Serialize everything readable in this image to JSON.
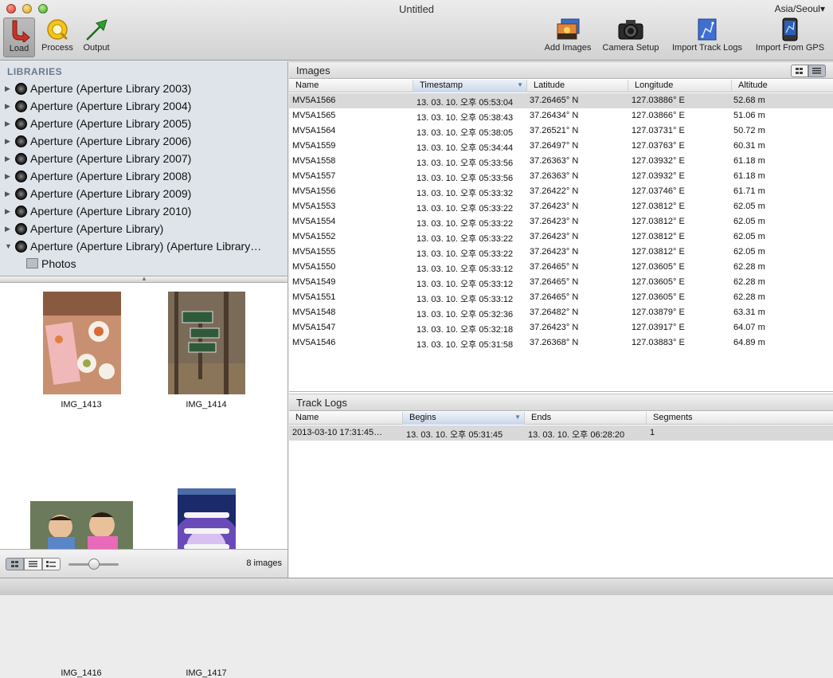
{
  "window": {
    "title": "Untitled",
    "timezone": "Asia/Seoul▾"
  },
  "toolbar": {
    "load": "Load",
    "process": "Process",
    "output": "Output",
    "add_images": "Add Images",
    "camera_setup": "Camera Setup",
    "import_track_logs": "Import Track Logs",
    "import_from_gps": "Import From GPS"
  },
  "sidebar": {
    "header": "LIBRARIES",
    "items": [
      {
        "label": "Aperture (Aperture Library 2003)"
      },
      {
        "label": "Aperture (Aperture Library 2004)"
      },
      {
        "label": "Aperture (Aperture Library 2005)"
      },
      {
        "label": "Aperture (Aperture Library 2006)"
      },
      {
        "label": "Aperture (Aperture Library 2007)"
      },
      {
        "label": "Aperture (Aperture Library 2008)"
      },
      {
        "label": "Aperture (Aperture Library 2009)"
      },
      {
        "label": "Aperture (Aperture Library 2010)"
      },
      {
        "label": "Aperture (Aperture Library)"
      },
      {
        "label": "Aperture (Aperture Library) (Aperture Library…"
      }
    ],
    "child": "Photos"
  },
  "thumbnails": [
    {
      "caption": "IMG_1413"
    },
    {
      "caption": "IMG_1414"
    },
    {
      "caption": "IMG_1416"
    },
    {
      "caption": "IMG_1417"
    }
  ],
  "thumb_status": "8 images",
  "images": {
    "title": "Images",
    "columns": [
      "Name",
      "Timestamp",
      "Latitude",
      "Longitude",
      "Altitude"
    ],
    "rows": [
      [
        "MV5A1566",
        "13. 03. 10. 오후 05:53:04",
        "37.26465° N",
        "127.03886° E",
        "52.68 m"
      ],
      [
        "MV5A1565",
        "13. 03. 10. 오후 05:38:43",
        "37.26434° N",
        "127.03866° E",
        "51.06 m"
      ],
      [
        "MV5A1564",
        "13. 03. 10. 오후 05:38:05",
        "37.26521° N",
        "127.03731° E",
        "50.72 m"
      ],
      [
        "MV5A1559",
        "13. 03. 10. 오후 05:34:44",
        "37.26497° N",
        "127.03763° E",
        "60.31 m"
      ],
      [
        "MV5A1558",
        "13. 03. 10. 오후 05:33:56",
        "37.26363° N",
        "127.03932° E",
        "61.18 m"
      ],
      [
        "MV5A1557",
        "13. 03. 10. 오후 05:33:56",
        "37.26363° N",
        "127.03932° E",
        "61.18 m"
      ],
      [
        "MV5A1556",
        "13. 03. 10. 오후 05:33:32",
        "37.26422° N",
        "127.03746° E",
        "61.71 m"
      ],
      [
        "MV5A1553",
        "13. 03. 10. 오후 05:33:22",
        "37.26423° N",
        "127.03812° E",
        "62.05 m"
      ],
      [
        "MV5A1554",
        "13. 03. 10. 오후 05:33:22",
        "37.26423° N",
        "127.03812° E",
        "62.05 m"
      ],
      [
        "MV5A1552",
        "13. 03. 10. 오후 05:33:22",
        "37.26423° N",
        "127.03812° E",
        "62.05 m"
      ],
      [
        "MV5A1555",
        "13. 03. 10. 오후 05:33:22",
        "37.26423° N",
        "127.03812° E",
        "62.05 m"
      ],
      [
        "MV5A1550",
        "13. 03. 10. 오후 05:33:12",
        "37.26465° N",
        "127.03605° E",
        "62.28 m"
      ],
      [
        "MV5A1549",
        "13. 03. 10. 오후 05:33:12",
        "37.26465° N",
        "127.03605° E",
        "62.28 m"
      ],
      [
        "MV5A1551",
        "13. 03. 10. 오후 05:33:12",
        "37.26465° N",
        "127.03605° E",
        "62.28 m"
      ],
      [
        "MV5A1548",
        "13. 03. 10. 오후 05:32:36",
        "37.26482° N",
        "127.03879° E",
        "63.31 m"
      ],
      [
        "MV5A1547",
        "13. 03. 10. 오후 05:32:18",
        "37.26423° N",
        "127.03917° E",
        "64.07 m"
      ],
      [
        "MV5A1546",
        "13. 03. 10. 오후 05:31:58",
        "37.26368° N",
        "127.03883° E",
        "64.89 m"
      ]
    ]
  },
  "track_logs": {
    "title": "Track Logs",
    "columns": [
      "Name",
      "Begins",
      "Ends",
      "Segments"
    ],
    "rows": [
      [
        "2013-03-10 17:31:45…",
        "13. 03. 10. 오후 05:31:45",
        "13. 03. 10. 오후 06:28:20",
        "1"
      ]
    ]
  }
}
